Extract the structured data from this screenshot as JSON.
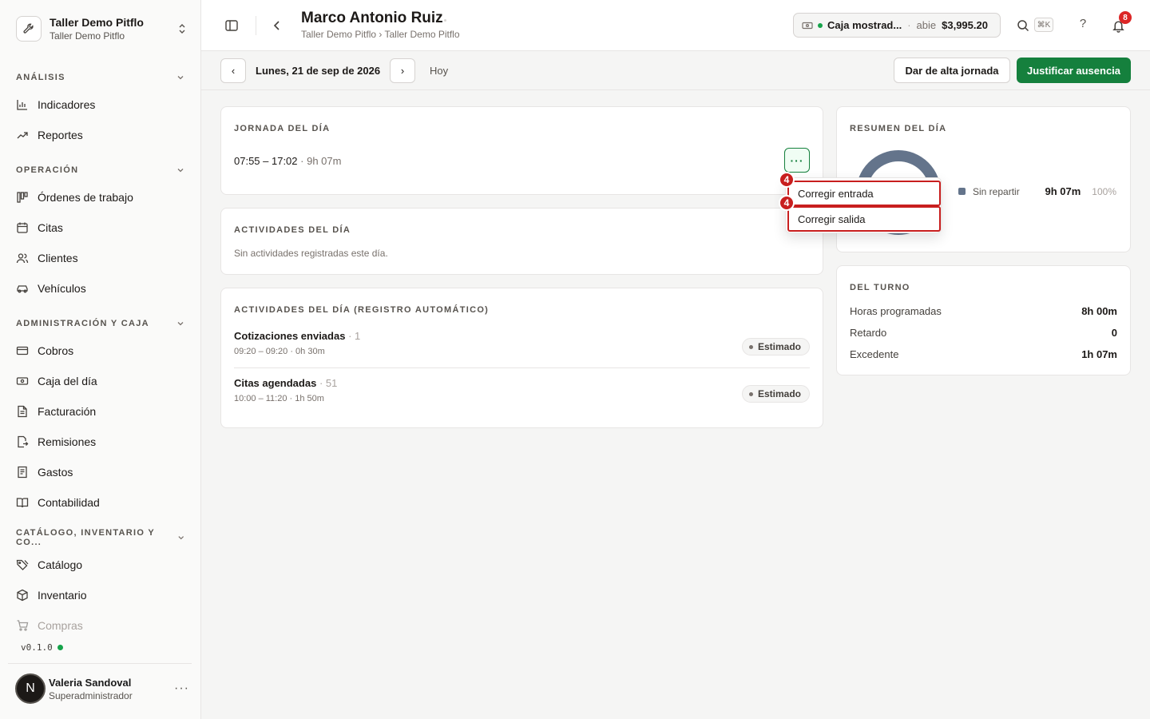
{
  "org": {
    "name": "Taller Demo Pitflo",
    "sub": "Taller Demo Pitflo"
  },
  "sidebar": {
    "sections": [
      {
        "title": "ANÁLISIS",
        "items": [
          "Indicadores",
          "Reportes"
        ]
      },
      {
        "title": "OPERACIÓN",
        "items": [
          "Órdenes de trabajo",
          "Citas",
          "Clientes",
          "Vehículos"
        ]
      },
      {
        "title": "ADMINISTRACIÓN Y CAJA",
        "items": [
          "Cobros",
          "Caja del día",
          "Facturación",
          "Remisiones",
          "Gastos",
          "Contabilidad"
        ]
      },
      {
        "title": "CATÁLOGO, INVENTARIO Y CO...",
        "items": [
          "Catálogo",
          "Inventario",
          "Compras"
        ]
      }
    ],
    "version": "v0.1.0",
    "user": {
      "initial": "N",
      "name": "Valeria Sandoval",
      "role": "Superadministrador",
      "more": "···"
    }
  },
  "header": {
    "title": "Marco Antonio Ruiz",
    "breadcrumb": "Taller Demo Pitflo › Taller Demo Pitflo",
    "cash": {
      "name": "Caja mostrad...",
      "sep": "·",
      "status": "abie",
      "amount": "$3,995.20"
    },
    "shortcut": "⌘K",
    "help": "?",
    "notifications": "8"
  },
  "datebar": {
    "prev": "‹",
    "date": "Lunes, 21 de sep de 2026",
    "next": "›",
    "today": "Hoy",
    "register_label": "Dar de alta jornada",
    "justify_label": "Justificar ausencia"
  },
  "shift": {
    "heading": "JORNADA DEL DÍA",
    "range": "07:55 – 17:02",
    "duration": " · 9h 07m",
    "more": "···"
  },
  "activities": {
    "heading": "ACTIVIDADES DEL DÍA",
    "empty": "Sin actividades registradas este día."
  },
  "auto_activities": {
    "heading": "ACTIVIDADES DEL DÍA (REGISTRO AUTOMÁTICO)",
    "items": [
      {
        "title": "Cotizaciones enviadas",
        "count": " · 1",
        "sub": "09:20 – 09:20 · 0h 30m",
        "tag": "Estimado"
      },
      {
        "title": "Citas agendadas",
        "count": " · 51",
        "sub": "10:00 – 11:20 · 1h 50m",
        "tag": "Estimado"
      }
    ]
  },
  "summary": {
    "heading": "RESUMEN DEL DÍA",
    "legend": {
      "label": "Sin repartir",
      "hours": "9h 07m",
      "percent": "100%",
      "fraction": 1.0,
      "color": "#64748b"
    }
  },
  "turn": {
    "heading": "DEL TURNO",
    "rows": [
      {
        "label": "Horas programadas",
        "value": "8h 00m"
      },
      {
        "label": "Retardo",
        "value": "0"
      },
      {
        "label": "Excedente",
        "value": "1h 07m"
      }
    ]
  },
  "menu": {
    "items": [
      {
        "label": "Corregir entrada",
        "marker": "4"
      },
      {
        "label": "Corregir salida",
        "marker": "4"
      }
    ]
  },
  "colors": {
    "brand": "#15803d",
    "marker": "#c81e1e",
    "chart": "#64748b"
  }
}
